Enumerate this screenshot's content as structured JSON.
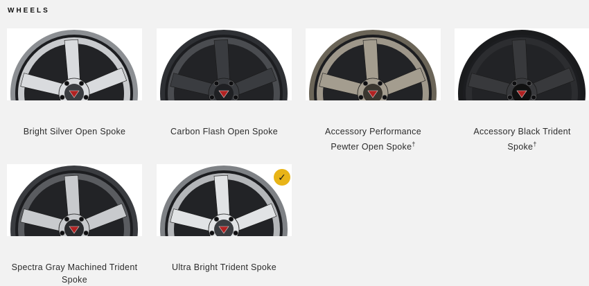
{
  "section": {
    "title": "WHEELS"
  },
  "wheels": [
    {
      "name": "Bright Silver Open Spoke",
      "dagger": "",
      "selected": false,
      "colors": {
        "rim": "#8c8f93",
        "face": "#c9cbce",
        "spoke": "#d9dbde",
        "hub": "#3a3c40"
      }
    },
    {
      "name": "Carbon Flash Open Spoke",
      "dagger": "",
      "selected": false,
      "colors": {
        "rim": "#2e3034",
        "face": "#4a4c50",
        "spoke": "#3a3c40",
        "hub": "#1f2023"
      }
    },
    {
      "name": "Accessory Performance Pewter Open Spoke",
      "dagger": "†",
      "selected": false,
      "colors": {
        "rim": "#6b6558",
        "face": "#9e978a",
        "spoke": "#a49d8f",
        "hub": "#3a362f"
      }
    },
    {
      "name": "Accessory Black Trident Spoke",
      "dagger": "†",
      "selected": false,
      "colors": {
        "rim": "#1a1b1d",
        "face": "#2c2d30",
        "spoke": "#38393c",
        "hub": "#111"
      }
    },
    {
      "name": "Spectra Gray Machined Trident Spoke",
      "dagger": "",
      "selected": false,
      "colors": {
        "rim": "#3a3c40",
        "face": "#5a5c60",
        "spoke": "#c8cacd",
        "hub": "#2a2b2e"
      }
    },
    {
      "name": "Ultra Bright Trident Spoke",
      "dagger": "",
      "selected": true,
      "colors": {
        "rim": "#7e8185",
        "face": "#b4b6b9",
        "spoke": "#e1e3e5",
        "hub": "#3a3c40"
      }
    }
  ],
  "icons": {
    "selected": "check-icon"
  },
  "accent": "#e8b417"
}
